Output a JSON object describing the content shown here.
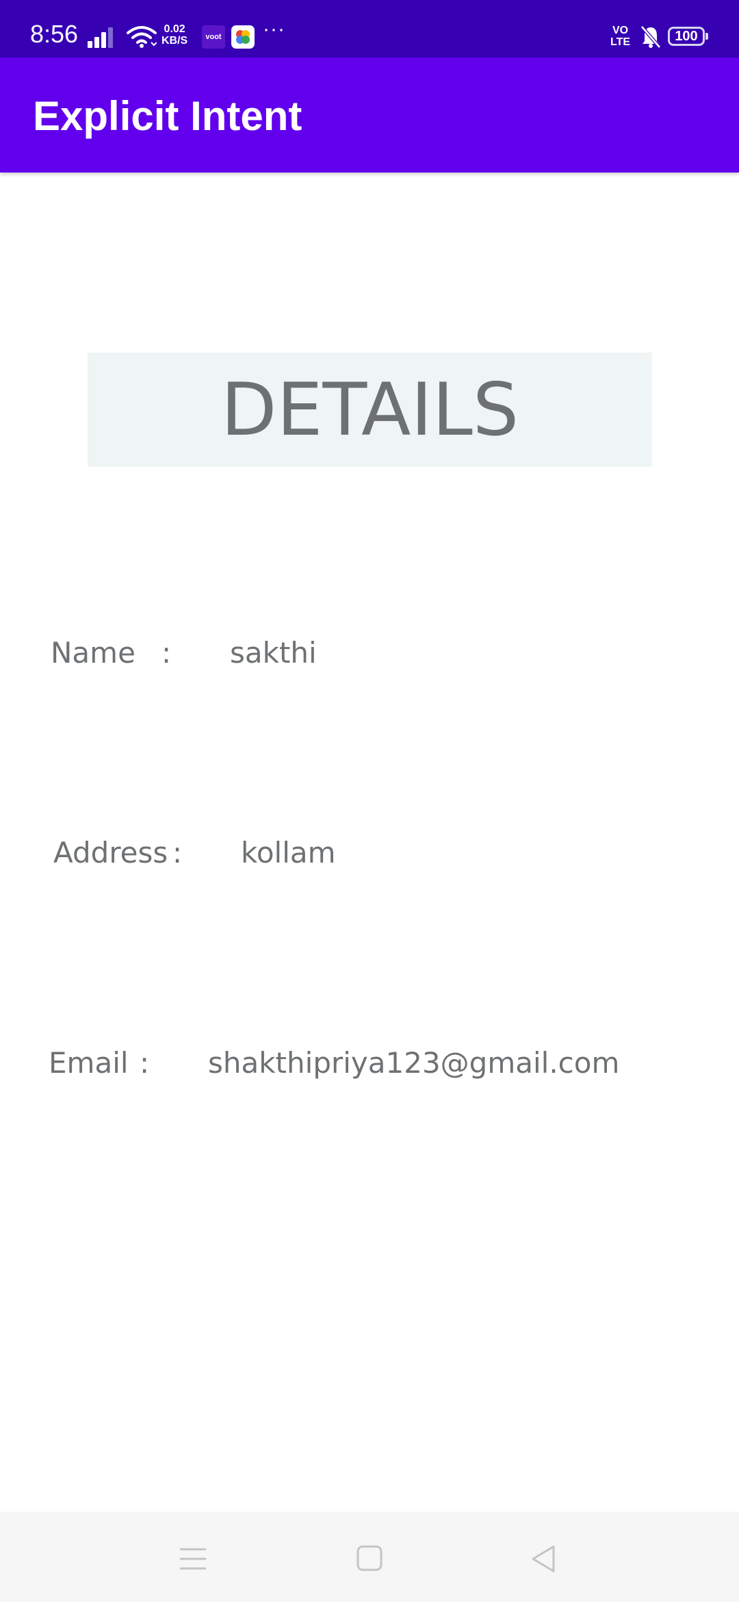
{
  "status_bar": {
    "time": "8:56",
    "network_speed_value": "0.02",
    "network_speed_unit": "KB/S",
    "voot_label": "voot",
    "more": "···",
    "volte_top": "VO",
    "volte_bottom": "LTE",
    "battery_level": "100",
    "icons": [
      "signal-icon",
      "wifi-icon",
      "voot-app-icon",
      "photos-app-icon",
      "more-dots-icon",
      "volte-icon",
      "bell-muted-icon",
      "battery-icon"
    ]
  },
  "app_bar": {
    "title": "Explicit Intent"
  },
  "details": {
    "header": "DETAILS",
    "name_label": "Name",
    "name_sep": ":",
    "name_value": "sakthi",
    "address_label": "Address",
    "address_sep": ":",
    "address_value": "kollam",
    "email_label": "Email",
    "email_sep": ":",
    "email_value": "shakthipriya123@gmail.com"
  },
  "nav_bar": {
    "icons": [
      "menu-icon",
      "home-icon",
      "back-icon"
    ]
  },
  "colors": {
    "status_bar": "#3700b3",
    "app_bar": "#6200ee",
    "details_bg": "#eff4f4",
    "text_gray": "#6e7173"
  }
}
